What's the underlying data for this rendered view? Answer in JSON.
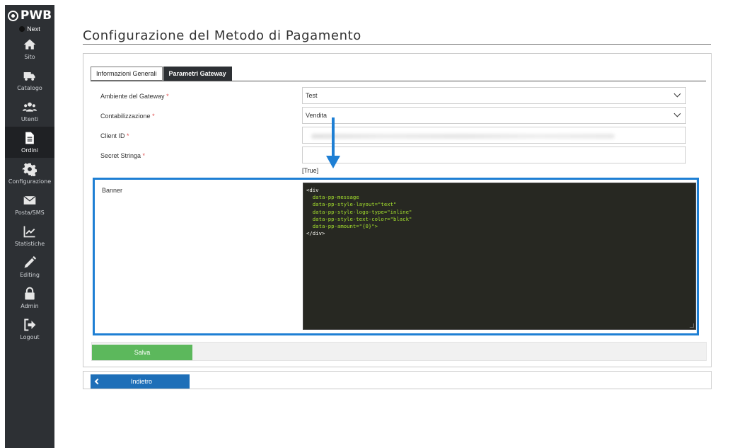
{
  "sidebar": {
    "brand": "PWB",
    "next_label": "Next",
    "items": [
      {
        "label": "Sito",
        "icon": "home-icon"
      },
      {
        "label": "Catalogo",
        "icon": "truck-icon"
      },
      {
        "label": "Utenti",
        "icon": "users-icon"
      },
      {
        "label": "Ordini",
        "icon": "document-icon",
        "active": true
      },
      {
        "label": "Configurazione",
        "icon": "gear-icon"
      },
      {
        "label": "Posta/SMS",
        "icon": "envelope-icon"
      },
      {
        "label": "Statistiche",
        "icon": "chart-icon"
      },
      {
        "label": "Editing",
        "icon": "pencil-icon"
      },
      {
        "label": "Admin",
        "icon": "lock-icon"
      },
      {
        "label": "Logout",
        "icon": "logout-icon"
      }
    ]
  },
  "page": {
    "title": "Configurazione del Metodo di Pagamento"
  },
  "tabs": [
    {
      "label": "Informazioni Generali",
      "active": false
    },
    {
      "label": "Parametri Gateway",
      "active": true
    }
  ],
  "form": {
    "required_mark": "*",
    "ambiente": {
      "label": "Ambiente del Gateway",
      "value": "Test"
    },
    "contabilizzazione": {
      "label": "Contabilizzazione",
      "value": "Vendita"
    },
    "client_id": {
      "label": "Client ID",
      "value": ""
    },
    "secret": {
      "label": "Secret Stringa",
      "value": ""
    },
    "true_text": "[True]",
    "banner": {
      "label": "Banner",
      "code_lines": [
        "<div",
        "  data-pp-message",
        "  data-pp-style-layout=\"text\"",
        "  data-pp-style-logo-type=\"inline\"",
        "  data-pp-style-text-color=\"black\"",
        "  data-pp-amount=\"{0}\">",
        "</div>"
      ]
    }
  },
  "buttons": {
    "save": "Salva",
    "back": "Indietro"
  },
  "colors": {
    "sidebar": "#2d3034",
    "highlight": "#1e7fd4",
    "save": "#5cb85c",
    "back": "#1e6fb8"
  }
}
